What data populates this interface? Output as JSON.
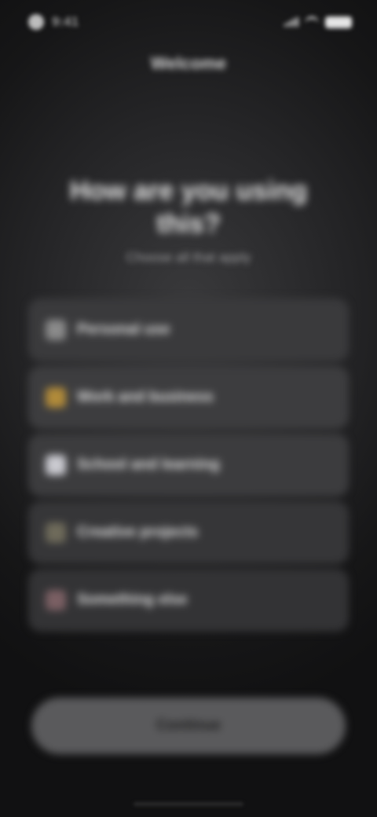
{
  "status_bar": {
    "time": "9:41",
    "icons": [
      "signal-icon",
      "wifi-icon",
      "battery-icon"
    ]
  },
  "nav": {
    "title": "Welcome"
  },
  "headline": {
    "title": "How are you using this?",
    "subtitle": "Choose all that apply"
  },
  "options": [
    {
      "label": "Personal use",
      "icon": "person-icon",
      "color": "#8a8a8a"
    },
    {
      "label": "Work and business",
      "icon": "briefcase-icon",
      "color": "#b08a3a"
    },
    {
      "label": "School and learning",
      "icon": "book-icon",
      "color": "#c9c9cf"
    },
    {
      "label": "Creative projects",
      "icon": "palette-icon",
      "color": "#6e6a5a"
    },
    {
      "label": "Something else",
      "icon": "sparkle-icon",
      "color": "#7a5f63"
    }
  ],
  "primary_button": {
    "label": "Continue"
  },
  "colors": {
    "background": "#111112",
    "card": "#3a3a3c",
    "button": "#5a5a5c"
  }
}
